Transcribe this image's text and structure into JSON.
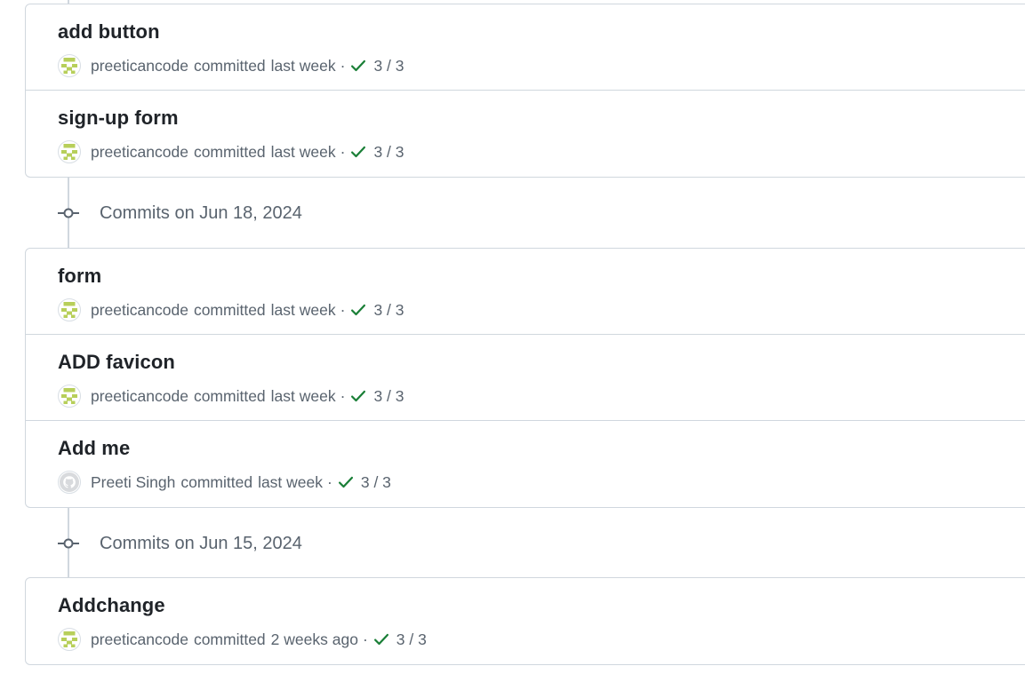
{
  "colors": {
    "border": "#d0d7de",
    "muted": "#59636e",
    "success": "#1a7f37",
    "avatar_green": "#b7cf5a"
  },
  "group_top": {
    "commits": [
      {
        "title": "add button",
        "author": "preeticancode",
        "action": "committed",
        "time": "last week",
        "separator": "·",
        "checks": "3 / 3",
        "avatar_icon": "identicon-avatar-icon"
      },
      {
        "title": "sign-up form",
        "author": "preeticancode",
        "action": "committed",
        "time": "last week",
        "separator": "·",
        "checks": "3 / 3",
        "avatar_icon": "identicon-avatar-icon"
      }
    ]
  },
  "date_headers": [
    {
      "label": "Commits on Jun 18, 2024",
      "icon": "git-commit-icon"
    },
    {
      "label": "Commits on Jun 15, 2024",
      "icon": "git-commit-icon"
    }
  ],
  "group_jun18": {
    "commits": [
      {
        "title": "form",
        "author": "preeticancode",
        "action": "committed",
        "time": "last week",
        "separator": "·",
        "checks": "3 / 3",
        "avatar_icon": "identicon-avatar-icon"
      },
      {
        "title": "ADD favicon",
        "author": "preeticancode",
        "action": "committed",
        "time": "last week",
        "separator": "·",
        "checks": "3 / 3",
        "avatar_icon": "identicon-avatar-icon"
      },
      {
        "title": "Add me",
        "author": "Preeti Singh",
        "action": "committed",
        "time": "last week",
        "separator": "·",
        "checks": "3 / 3",
        "avatar_icon": "github-avatar-icon"
      }
    ]
  },
  "group_jun15": {
    "commits": [
      {
        "title": "Addchange",
        "author": "preeticancode",
        "action": "committed",
        "time": "2 weeks ago",
        "separator": "·",
        "checks": "3 / 3",
        "avatar_icon": "identicon-avatar-icon"
      }
    ]
  }
}
